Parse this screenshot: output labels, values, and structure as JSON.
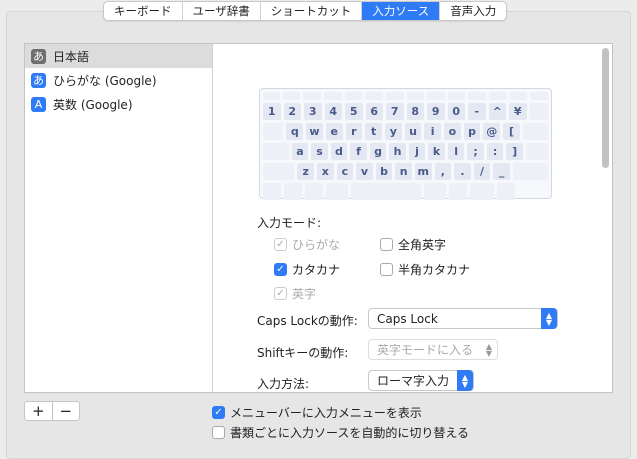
{
  "tabs": [
    {
      "label": "キーボード",
      "selected": false
    },
    {
      "label": "ユーザ辞書",
      "selected": false
    },
    {
      "label": "ショートカット",
      "selected": false
    },
    {
      "label": "入力ソース",
      "selected": true
    },
    {
      "label": "音声入力",
      "selected": false
    }
  ],
  "sources": [
    {
      "icon": "あ",
      "label": "日本語",
      "color": "#6e6e6e",
      "selected": true
    },
    {
      "icon": "あ",
      "label": "ひらがな (Google)",
      "color": "#2f7bf5",
      "selected": false
    },
    {
      "icon": "A",
      "label": "英数 (Google)",
      "color": "#2f7bf5",
      "selected": false
    }
  ],
  "keyboard": {
    "rows": [
      [
        "1",
        "2",
        "3",
        "4",
        "5",
        "6",
        "7",
        "8",
        "9",
        "0",
        "-",
        "^",
        "¥"
      ],
      [
        "q",
        "w",
        "e",
        "r",
        "t",
        "y",
        "u",
        "i",
        "o",
        "p",
        "@",
        "["
      ],
      [
        "a",
        "s",
        "d",
        "f",
        "g",
        "h",
        "j",
        "k",
        "l",
        ";",
        ":",
        "]"
      ],
      [
        "z",
        "x",
        "c",
        "v",
        "b",
        "n",
        "m",
        ",",
        ".",
        "/",
        "_"
      ]
    ]
  },
  "input_mode": {
    "label": "入力モード:",
    "hiragana": "ひらがな",
    "zenkaku_eiji": "全角英字",
    "katakana": "カタカナ",
    "hankaku_katakana": "半角カタカナ",
    "eiji": "英字"
  },
  "caps_lock": {
    "label": "Caps Lockの動作:",
    "value": "Caps Lock"
  },
  "shift": {
    "label": "Shiftキーの動作:",
    "value": "英字モードに入る"
  },
  "input_method": {
    "label": "入力方法:",
    "value": "ローマ字入力"
  },
  "buttons": {
    "add": "+",
    "remove": "−"
  },
  "options": {
    "show_menu": "メニューバーに入力メニューを表示",
    "auto_switch": "書類ごとに入力ソースを自動的に切り替える"
  }
}
